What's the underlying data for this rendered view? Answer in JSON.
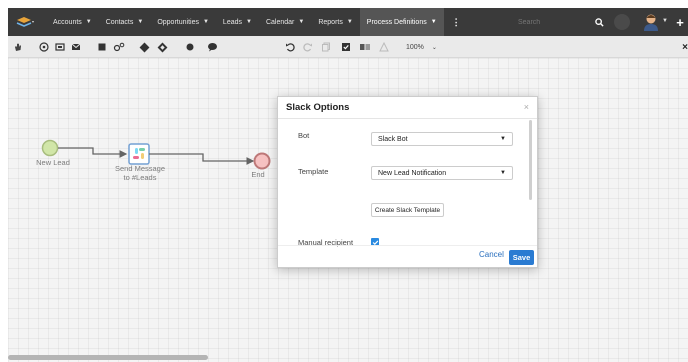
{
  "nav": {
    "items": [
      {
        "label": "Accounts"
      },
      {
        "label": "Contacts"
      },
      {
        "label": "Opportunities"
      },
      {
        "label": "Leads"
      },
      {
        "label": "Calendar"
      },
      {
        "label": "Reports"
      },
      {
        "label": "Process Definitions"
      }
    ],
    "more_label": "⋮",
    "search_placeholder": "Search",
    "plus_label": "+"
  },
  "toolbar": {
    "zoom_label": "100%"
  },
  "diagram": {
    "start_label": "New Lead",
    "task_label_line1": "Send Message",
    "task_label_line2": "to #Leads",
    "end_label": "End",
    "colors": {
      "start_fill": "#b9d97a",
      "start_stroke": "#7a9a3a",
      "end_fill": "#f2a0a0",
      "end_stroke": "#9a3030"
    }
  },
  "modal": {
    "title": "Slack Options",
    "close_label": "×",
    "fields": {
      "bot_label": "Bot",
      "bot_value": "Slack Bot",
      "template_label": "Template",
      "template_value": "New Lead Notification",
      "create_template_button": "Create Slack Template",
      "manual_recipient_label": "Manual recipient"
    },
    "cancel_label": "Cancel",
    "save_label": "Save"
  }
}
